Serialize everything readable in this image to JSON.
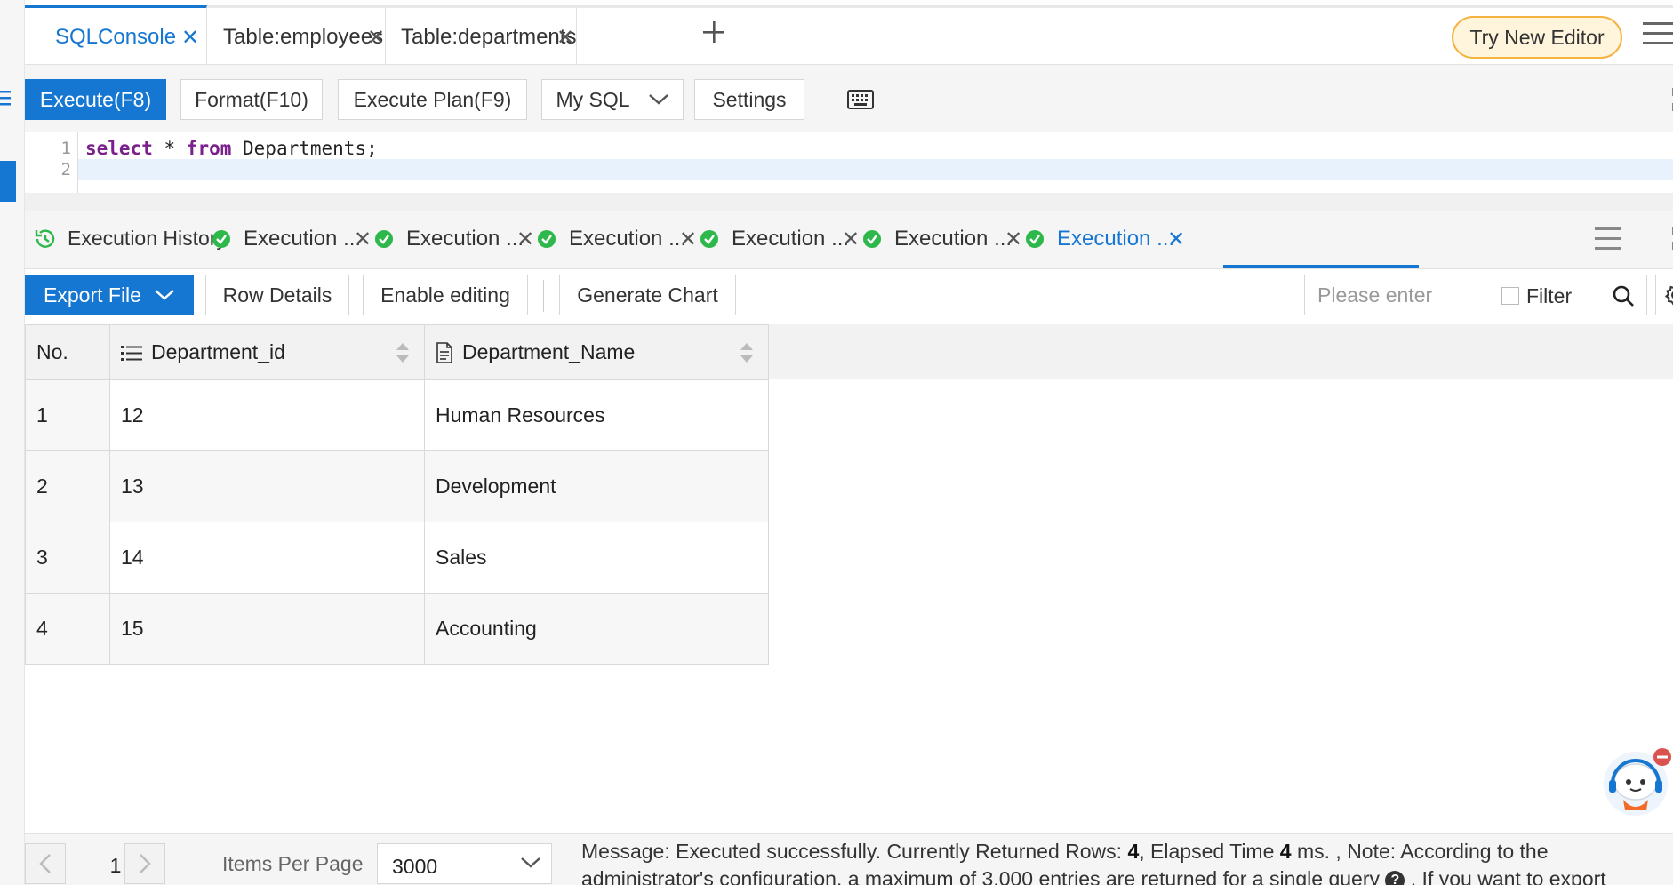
{
  "tabs": [
    {
      "label": "SQLConsole",
      "active": true
    },
    {
      "label": "Table:employees",
      "active": false
    },
    {
      "label": "Table:departments",
      "active": false
    }
  ],
  "header": {
    "try_new_editor": "Try New Editor"
  },
  "toolbar": {
    "execute": "Execute(F8)",
    "format": "Format(F10)",
    "execute_plan": "Execute Plan(F9)",
    "dialect": "My SQL",
    "settings": "Settings"
  },
  "editor": {
    "line_numbers": [
      "1",
      "2"
    ],
    "keyword_select": "select",
    "code_star": " * ",
    "keyword_from": "from",
    "code_rest": " Departments;"
  },
  "result_tabs": {
    "history_label": "Execution History",
    "items": [
      {
        "label": "Execution ...",
        "active": false
      },
      {
        "label": "Execution ...",
        "active": false
      },
      {
        "label": "Execution ...",
        "active": false
      },
      {
        "label": "Execution ...",
        "active": false
      },
      {
        "label": "Execution ...",
        "active": false
      },
      {
        "label": "Execution ...",
        "active": true
      }
    ]
  },
  "result_toolbar": {
    "export_file": "Export File",
    "row_details": "Row Details",
    "enable_editing": "Enable editing",
    "generate_chart": "Generate Chart",
    "search_placeholder": "Please enter",
    "filter_label": "Filter"
  },
  "table": {
    "columns": [
      "No.",
      "Department_id",
      "Department_Name"
    ],
    "rows": [
      {
        "no": "1",
        "id": "12",
        "name": "Human Resources"
      },
      {
        "no": "2",
        "id": "13",
        "name": "Development"
      },
      {
        "no": "3",
        "id": "14",
        "name": "Sales"
      },
      {
        "no": "4",
        "id": "15",
        "name": "Accounting"
      }
    ]
  },
  "footer": {
    "page": "1",
    "items_per_page_label": "Items Per Page",
    "items_per_page_value": "3000",
    "message_prefix": "Message: Executed successfully. Currently Returned Rows: ",
    "rows_returned": "4",
    "message_mid": ", Elapsed Time ",
    "elapsed": "4",
    "message_suffix": " ms. ,   Note: According to the administrator's configuration, a maximum of 3,000 entries are returned for a single query ",
    "message_tail": " . If you want to export"
  },
  "colors": {
    "accent": "#1677d2",
    "success": "#2eb84b",
    "try_editor_bg": "#fff4dc",
    "try_editor_border": "#f5b342",
    "keyword": "#7a1f8c"
  },
  "icons": [
    "menu-icon",
    "close-icon",
    "plus-icon",
    "hamburger-icon",
    "chevron-down-icon",
    "keyboard-icon",
    "expand-icon",
    "history-icon",
    "check-circle-icon",
    "search-icon",
    "gear-icon",
    "list-icon",
    "document-icon",
    "sort-icon",
    "chevron-left-icon",
    "chevron-right-icon",
    "help-icon",
    "assistant-icon"
  ]
}
